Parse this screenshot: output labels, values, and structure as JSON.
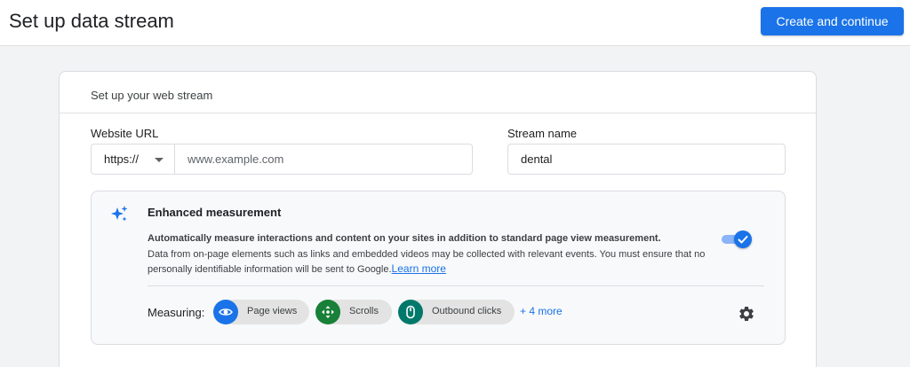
{
  "header": {
    "title": "Set up data stream",
    "primary_button": "Create and continue"
  },
  "card": {
    "title": "Set up your web stream",
    "website_url": {
      "label": "Website URL",
      "protocol": "https://",
      "placeholder": "www.example.com",
      "value": ""
    },
    "stream_name": {
      "label": "Stream name",
      "value": "dental"
    },
    "enhanced": {
      "title": "Enhanced measurement",
      "desc_bold": "Automatically measure interactions and content on your sites in addition to standard page view measurement.",
      "desc": "Data from on-page elements such as links and embedded videos may be collected with relevant events. You must ensure that no personally identifiable information will be sent to Google.",
      "learn_more": "Learn more",
      "toggle_on": true,
      "measuring_label": "Measuring:",
      "chips": [
        {
          "label": "Page views",
          "icon": "eye-icon",
          "color": "#1a73e8"
        },
        {
          "label": "Scrolls",
          "icon": "scroll-arrows-icon",
          "color": "#188038"
        },
        {
          "label": "Outbound clicks",
          "icon": "mouse-icon",
          "color": "#00796b"
        }
      ],
      "more_link": "+ 4 more"
    }
  },
  "colors": {
    "accent": "#1a73e8",
    "background": "#f1f3f4"
  }
}
